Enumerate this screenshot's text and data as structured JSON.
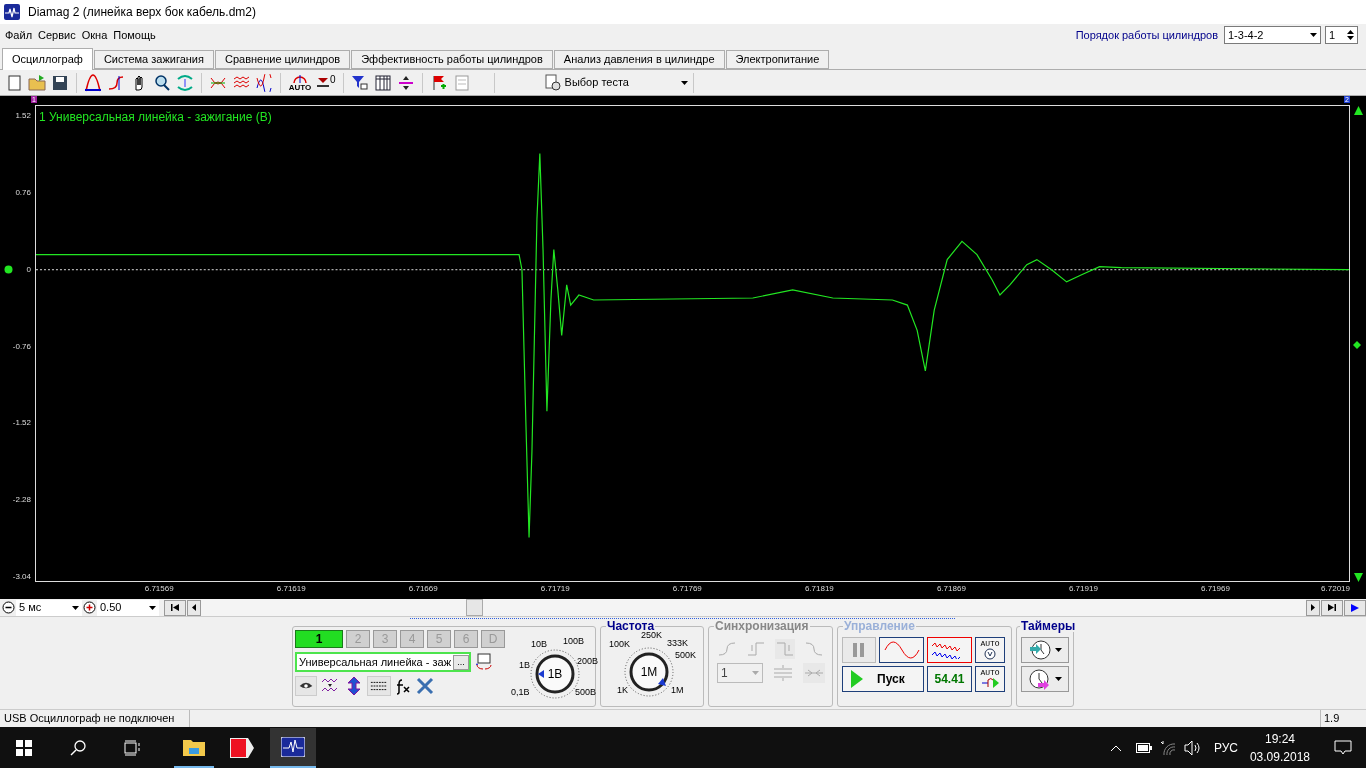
{
  "window": {
    "title": "Diamag 2 (линейка верх бок кабель.dm2)"
  },
  "menu": [
    "Файл",
    "Сервис",
    "Окна",
    "Помощь"
  ],
  "firing_order": {
    "label": "Порядок работы цилиндров",
    "value": "1-3-4-2",
    "cylinder": "1"
  },
  "tabs": [
    {
      "label": "Осциллограф",
      "selected": true
    },
    {
      "label": "Система зажигания",
      "selected": false
    },
    {
      "label": "Сравнение цилиндров",
      "selected": false
    },
    {
      "label": "Эффективность работы цилиндров",
      "selected": false
    },
    {
      "label": "Анализ давления в цилиндре",
      "selected": false
    },
    {
      "label": "Электропитание",
      "selected": false
    }
  ],
  "toolbar": {
    "test_select": "Выбор теста",
    "zero_label": "0",
    "auto_label": "AUTO"
  },
  "scope": {
    "markers": [
      "1",
      "2"
    ],
    "chart_data": {
      "type": "line",
      "xlim": [
        6.71521,
        6.72019
      ],
      "ylim": [
        -3.08,
        1.62
      ],
      "yticks": [
        1.52,
        0.76,
        0,
        -0.76,
        -1.52,
        -2.28,
        -3.04
      ],
      "xticks": [
        6.71569,
        6.71619,
        6.71669,
        6.71719,
        6.71769,
        6.71819,
        6.71869,
        6.71919,
        6.71969,
        6.72019
      ],
      "x": [
        6.71521,
        6.717042,
        6.717053,
        6.717068,
        6.71708,
        6.717091,
        6.71711,
        6.717121,
        6.717133,
        6.717148,
        6.717163,
        6.717174,
        6.717189,
        6.717204,
        6.717223,
        6.717238,
        6.717269,
        6.717325,
        6.717929,
        6.71808,
        6.718232,
        6.718458,
        6.718515,
        6.718552,
        6.718583,
        6.718617,
        6.718666,
        6.718722,
        6.718779,
        6.718836,
        6.718866,
        6.718904,
        6.718968,
        6.719006,
        6.719062,
        6.719119,
        6.719176,
        6.719244,
        6.719327,
        6.72019
      ],
      "series": [
        {
          "name": "1 Универсальная линейка - зажигание (В)",
          "color": "#22e622",
          "values": [
            0.15,
            0.15,
            0.0,
            -1.5,
            -2.65,
            -1.8,
            0.5,
            1.15,
            0.2,
            -1.4,
            -0.3,
            0.2,
            -0.2,
            -0.65,
            -0.15,
            -0.35,
            -0.25,
            -0.3,
            -0.28,
            -0.2,
            -0.28,
            -0.3,
            -0.35,
            -0.6,
            -1.0,
            -0.4,
            0.1,
            0.28,
            0.15,
            -0.1,
            -0.25,
            -0.15,
            0.05,
            0.1,
            0.0,
            -0.12,
            -0.05,
            0.03,
            0.02,
            0.0
          ]
        }
      ]
    }
  },
  "timebase": {
    "scale": "5 мс",
    "zoom": "0.50",
    "level": 0.24
  },
  "channels": [
    {
      "label": "1",
      "selected": true,
      "disabled": false
    },
    {
      "label": "2",
      "selected": false,
      "disabled": true
    },
    {
      "label": "3",
      "selected": false,
      "disabled": true
    },
    {
      "label": "4",
      "selected": false,
      "disabled": true
    },
    {
      "label": "5",
      "selected": false,
      "disabled": true
    },
    {
      "label": "6",
      "selected": false,
      "disabled": true
    },
    {
      "label": "D",
      "selected": false,
      "disabled": true
    }
  ],
  "channel_name": {
    "value": "Универсальная линейка - заж",
    "browse": "..."
  },
  "voltage_dial": {
    "labels": [
      "10В",
      "100В",
      "1В",
      "200В",
      "0,1В",
      "500В"
    ],
    "value": "1В"
  },
  "frequency": {
    "title": "Частота",
    "labels": [
      "100K",
      "250K",
      "333K",
      "500K",
      "1K",
      "1M"
    ],
    "value": "1M"
  },
  "sync": {
    "title": "Синхронизация",
    "disabled": true,
    "channel": "1"
  },
  "control": {
    "title": "Управление",
    "start": "Пуск",
    "reading": "54.41",
    "auto_labels": [
      "AUTO",
      "AUTO"
    ]
  },
  "timers": {
    "title": "Таймеры"
  },
  "status_bar": {
    "message": "USB Осциллограф не подключен",
    "version": "1.9"
  },
  "taskbar": {
    "language": "РУС",
    "time": "19:24",
    "date": "03.09.2018"
  }
}
